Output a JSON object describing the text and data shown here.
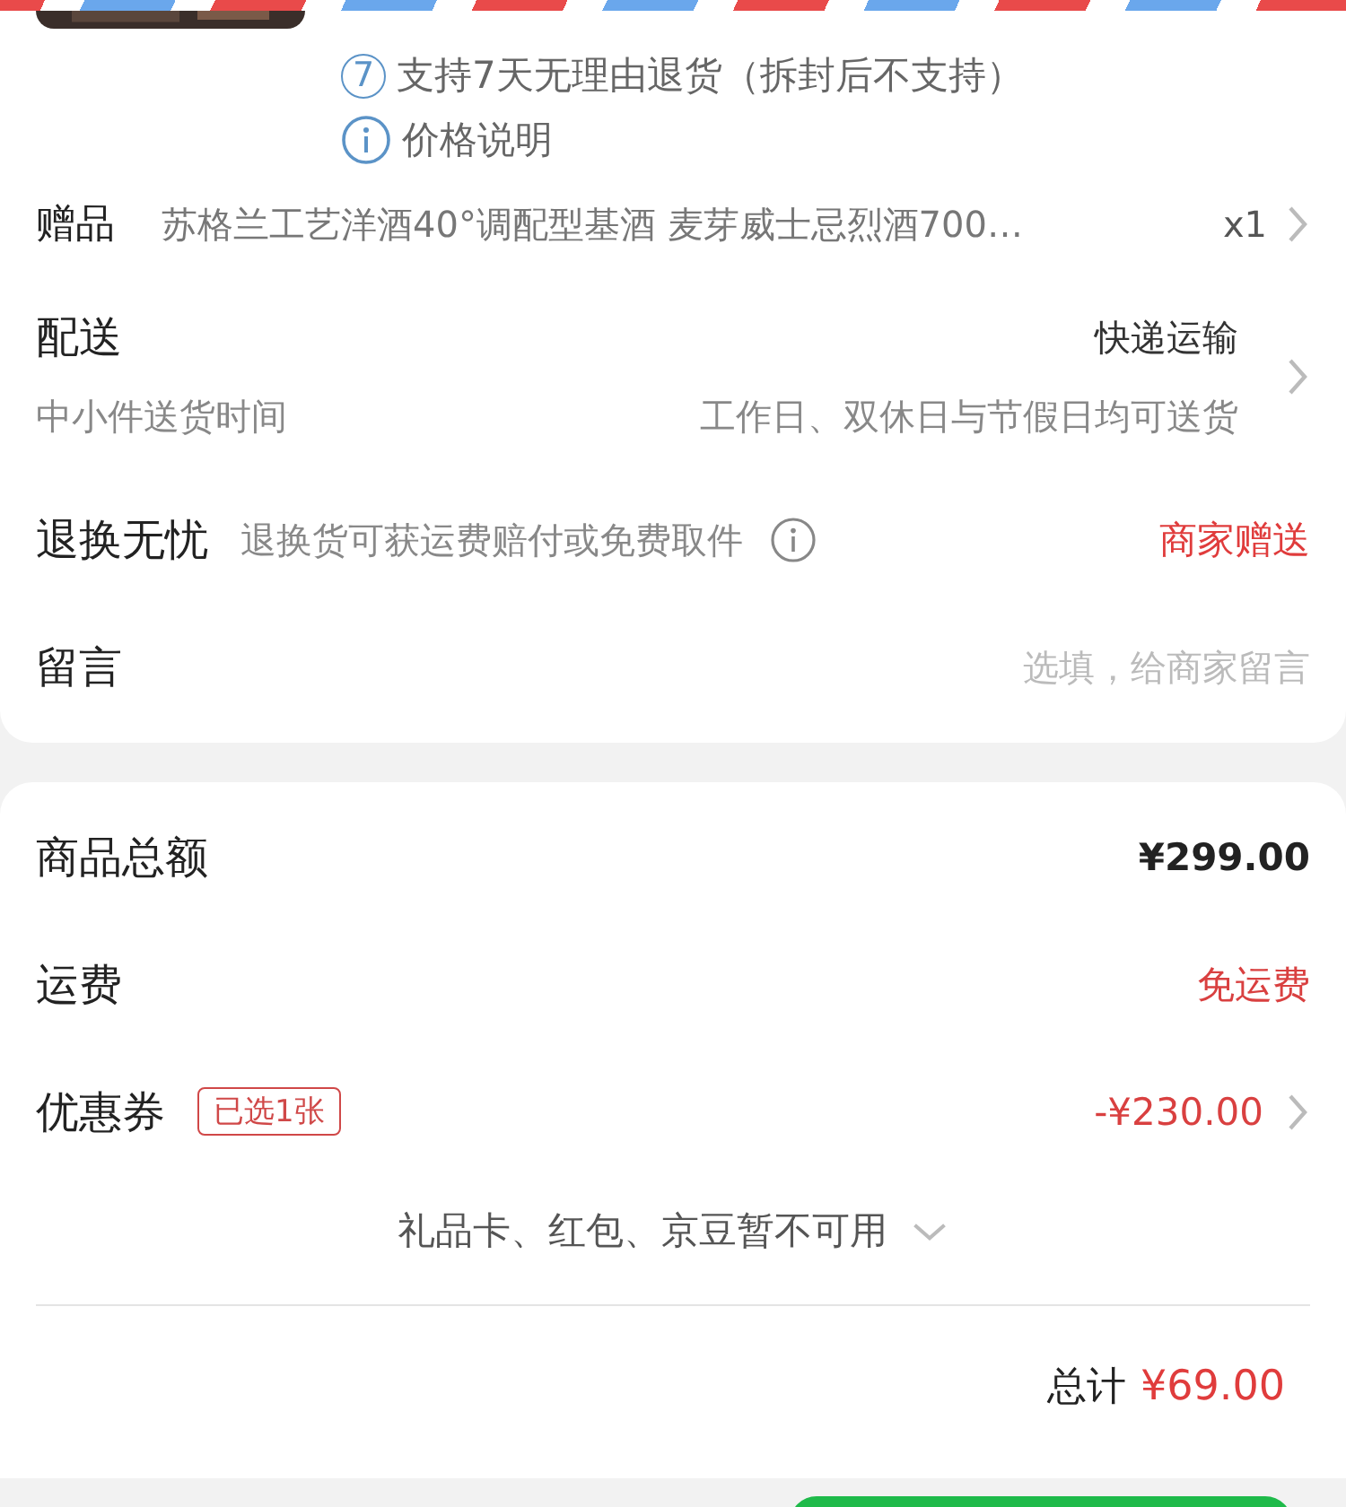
{
  "service_notes": [
    {
      "kind": "seven_day",
      "icon_text": "7",
      "text": "支持7天无理由退货（拆封后不支持）"
    },
    {
      "kind": "info",
      "text": "价格说明"
    }
  ],
  "gift": {
    "label": "赠品",
    "name": "苏格兰工艺洋酒40°调配型基酒 麦芽威士忌烈酒700…",
    "quantity": "x1"
  },
  "delivery": {
    "label": "配送",
    "method": "快递运输",
    "sub_label": "中小件送货时间",
    "schedule": "工作日、双休日与节假日均可送货"
  },
  "returns": {
    "label": "退换无忧",
    "description": "退换货可获运费赔付或免费取件",
    "value": "商家赠送"
  },
  "message": {
    "label": "留言",
    "placeholder": "选填，给商家留言"
  },
  "summary": [
    {
      "kind": "amount",
      "label": "商品总额",
      "value": "¥299.00"
    },
    {
      "kind": "shipping",
      "label": "运费",
      "value": "免运费"
    },
    {
      "kind": "coupon",
      "label": "优惠券",
      "badge": "已选1张",
      "value": "-¥230.00"
    }
  ],
  "unavailable": "礼品卡、红包、京豆暂不可用",
  "total": {
    "label": "总计",
    "value": "¥69.00"
  }
}
